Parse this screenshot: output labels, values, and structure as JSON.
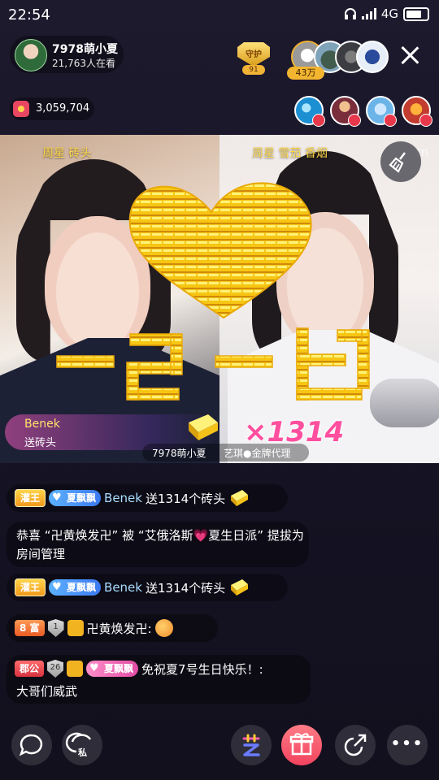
{
  "status_bar": {
    "time": "22:54",
    "network": "4G",
    "signal_icon": "signal-icon",
    "headphone_icon": "headphone-icon",
    "battery_level": 0.9
  },
  "header": {
    "host_name": "7978萌小夏",
    "viewers": "21,763人在看",
    "guard_label": "守护",
    "guard_count": "91",
    "fan_count": "43万",
    "coins": "3,059,704"
  },
  "video": {
    "left_label": "周星  砖头",
    "right_label": "周星 雪茄 香烟",
    "watermark": "cn",
    "gift_banner": {
      "user": "Benek",
      "desc": "送砖头",
      "multiplier": "×1314"
    },
    "caption": {
      "host": "7978萌小夏",
      "agent": "艺琪●金牌代理"
    }
  },
  "chat": [
    {
      "level_tag": "灌王",
      "fan_badge": "夏飘飘",
      "user": "Benek",
      "text": "送1314个砖头"
    },
    {
      "text": "恭喜 “卍黄焕发卍” 被 “艾俄洛斯💗夏生日派” 提拔为房间管理"
    },
    {
      "level_tag": "灌王",
      "fan_badge": "夏飘飘",
      "user": "Benek",
      "text": "送1314个砖头"
    },
    {
      "level_tag": "8 富",
      "guard_level": "1",
      "user": "卍黄焕发卍:",
      "text": ""
    },
    {
      "level_tag": "郡公",
      "guard_level": "26",
      "fan_badge": "夏飘飘",
      "text": "免祝夏7号生日快乐！:",
      "text2": "大哥们威武"
    }
  ],
  "bottom_bar": {
    "private_label": "私",
    "more_label": "•••"
  },
  "colors": {
    "accent_pink": "#ff4f9e",
    "gift_button": "#f2435e",
    "gold": "#ffd44a",
    "chat_blue": "#a9dcff"
  }
}
